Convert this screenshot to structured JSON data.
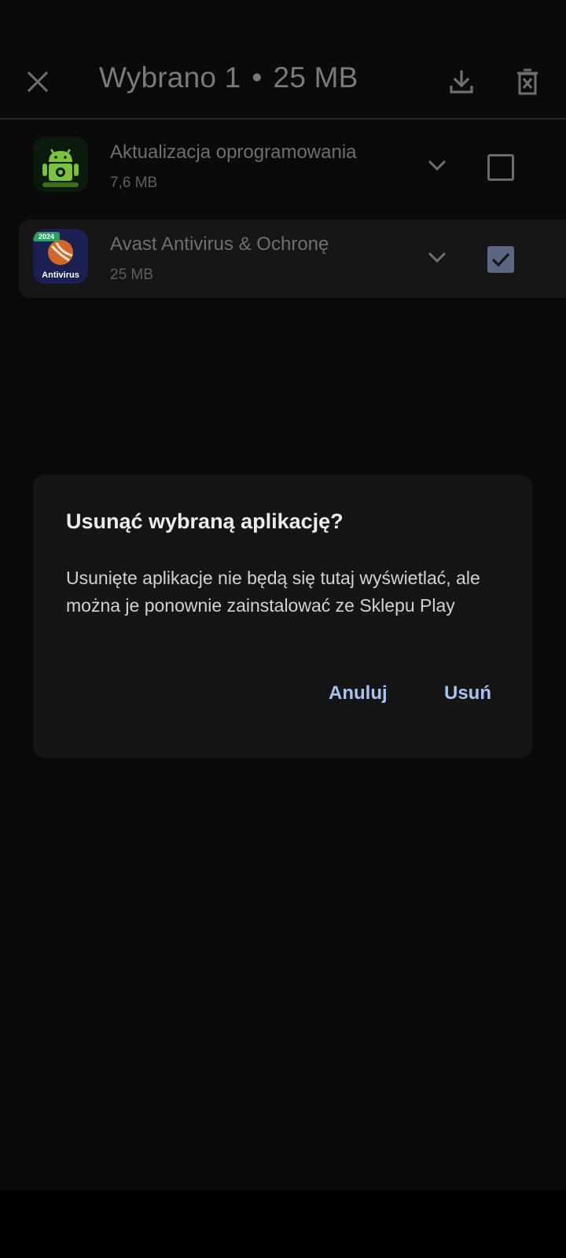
{
  "appbar": {
    "selected_label": "Wybrano 1",
    "separator": "•",
    "selected_size": "25 MB",
    "close_icon": "close-icon",
    "download_icon": "download-icon",
    "delete_icon": "delete-icon"
  },
  "items": [
    {
      "title": "Aktualizacja oprogramowania",
      "size": "7,6 MB",
      "checked": false,
      "icon": "android-update-icon"
    },
    {
      "title": "Avast Antivirus & Ochronę",
      "size": "25 MB",
      "checked": true,
      "icon": "antivirus-app-icon",
      "icon_badge": "2024",
      "icon_text": "Antivirus"
    }
  ],
  "dialog": {
    "title": "Usunąć wybraną aplikację?",
    "body": "Usunięte aplikacje nie będą się tutaj wyświetlać, ale można je ponownie zainstalować ze Sklepu Play",
    "cancel_label": "Anuluj",
    "confirm_label": "Usuń"
  },
  "colors": {
    "background": "#0a0a0a",
    "dialog_bg": "#151515",
    "accent": "#a7c2f3",
    "checkbox_checked": "#5a6682"
  }
}
